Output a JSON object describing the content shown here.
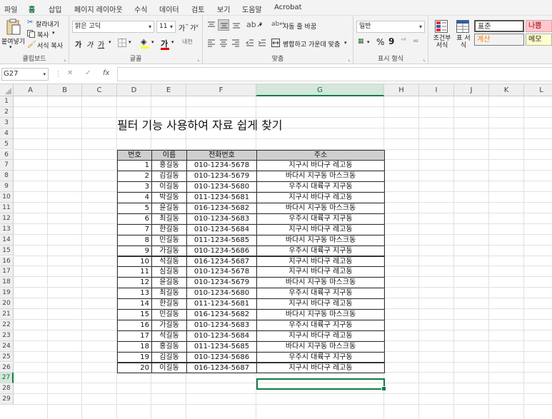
{
  "menu_tabs": [
    "파일",
    "홈",
    "삽입",
    "페이지 레이아웃",
    "수식",
    "데이터",
    "검토",
    "보기",
    "도움말",
    "Acrobat"
  ],
  "ribbon": {
    "clipboard": {
      "paste": "붙여넣기",
      "cut": "잘라내기",
      "copy": "복사",
      "format_painter": "서식 복사",
      "label": "클립보드"
    },
    "font": {
      "name": "맑은 고딕",
      "size": "11",
      "bold": "가",
      "italic": "가",
      "underline": "가",
      "grow": "가",
      "shrink": "가",
      "ruby": "내천",
      "label": "글꼴"
    },
    "alignment": {
      "wrap": "자동 줄 바꿈",
      "merge": "병합하고 가운데 맞춤",
      "label": "맞춤"
    },
    "number": {
      "format": "일반",
      "percent": "%",
      "comma": "9",
      "label": "표시 형식"
    },
    "styles": {
      "conditional": "조건부 서식",
      "table": "표 서식",
      "normal": "표준",
      "bad": "나쁨",
      "calc": "계산",
      "memo": "메모"
    }
  },
  "formula_bar": {
    "name_box": "G27",
    "fx": "fx",
    "formula": ""
  },
  "columns": [
    "A",
    "B",
    "C",
    "D",
    "E",
    "F",
    "G",
    "H",
    "I",
    "J",
    "K",
    "L"
  ],
  "rows": [
    "1",
    "2",
    "3",
    "4",
    "5",
    "6",
    "7",
    "8",
    "9",
    "10",
    "11",
    "12",
    "13",
    "14",
    "15",
    "16",
    "17",
    "18",
    "19",
    "20",
    "21",
    "22",
    "23",
    "24",
    "25",
    "26",
    "27",
    "28",
    "29"
  ],
  "sheet_title": "필터 기능 사용하여 자료 쉽게 찾기",
  "table": {
    "headers": [
      "번호",
      "이름",
      "전화번호",
      "주소"
    ],
    "rows": [
      [
        "1",
        "홍길동",
        "010-1234-5678",
        "지구시 바다구 레고동"
      ],
      [
        "2",
        "김길동",
        "010-1234-5679",
        "바다시 지구동 마스크동"
      ],
      [
        "3",
        "이길동",
        "010-1234-5680",
        "우주시 대륙구 지구동"
      ],
      [
        "4",
        "박길동",
        "011-1234-5681",
        "지구시 바다구 레고동"
      ],
      [
        "5",
        "윤길동",
        "016-1234-5682",
        "바다시 지구동 마스크동"
      ],
      [
        "6",
        "최길동",
        "010-1234-5683",
        "우주시 대륙구 지구동"
      ],
      [
        "7",
        "한길동",
        "010-1234-5684",
        "지구시 바다구 레고동"
      ],
      [
        "8",
        "민길동",
        "011-1234-5685",
        "바다시 지구동 마스크동"
      ],
      [
        "9",
        "가길동",
        "010-1234-5686",
        "우주시 대륙구 지구동"
      ],
      [
        "10",
        "석길동",
        "016-1234-5687",
        "지구시 바다구 레고동"
      ],
      [
        "11",
        "심길동",
        "010-1234-5678",
        "지구시 바다구 레고동"
      ],
      [
        "12",
        "윤길동",
        "010-1234-5679",
        "바다시 지구동 마스크동"
      ],
      [
        "13",
        "최길동",
        "010-1234-5680",
        "우주시 대륙구 지구동"
      ],
      [
        "14",
        "한길동",
        "011-1234-5681",
        "지구시 바다구 레고동"
      ],
      [
        "15",
        "민길동",
        "016-1234-5682",
        "바다시 지구동 마스크동"
      ],
      [
        "16",
        "가길동",
        "010-1234-5683",
        "우주시 대륙구 지구동"
      ],
      [
        "17",
        "석길동",
        "010-1234-5684",
        "지구시 바다구 레고동"
      ],
      [
        "18",
        "홍길동",
        "011-1234-5685",
        "바다시 지구동 마스크동"
      ],
      [
        "19",
        "김길동",
        "010-1234-5686",
        "우주시 대륙구 지구동"
      ],
      [
        "20",
        "이길동",
        "016-1234-5687",
        "지구시 바다구 레고동"
      ]
    ]
  },
  "selected_cell": "G27",
  "colors": {
    "accent": "#107c41",
    "header_fill": "#cfcfcf",
    "bad_fill": "#ffc7ce",
    "calc_fill": "#f2f2f2",
    "memo_fill": "#ffffcc"
  }
}
